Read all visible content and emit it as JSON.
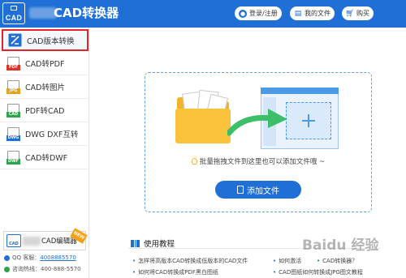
{
  "header": {
    "logo_text": "CAD",
    "title": "CAD转换器",
    "buttons": [
      {
        "label": "登录/注册",
        "icon": "user-icon"
      },
      {
        "label": "我的文件",
        "icon": "file-icon"
      },
      {
        "label": "购买",
        "icon": "cart-icon"
      }
    ]
  },
  "sidebar": {
    "items": [
      {
        "label": "CAD版本转换",
        "icon": "cad-version-icon",
        "band": "",
        "color": "#1f6fd6",
        "active": true
      },
      {
        "label": "CAD转PDF",
        "icon": "pdf-icon",
        "band": "PDF",
        "color": "#d9362a"
      },
      {
        "label": "CAD转图片",
        "icon": "image-icon",
        "band": "JPG",
        "color": "#e9a21c"
      },
      {
        "label": "PDF转CAD",
        "icon": "pdf-to-cad-icon",
        "band": "CAD",
        "color": "#2ea34a"
      },
      {
        "label": "DWG DXF互转",
        "icon": "dwg-dxf-icon",
        "band": "DWG",
        "color": "#1f6fd6"
      },
      {
        "label": "CAD转DWF",
        "icon": "dwf-icon",
        "band": "DWF",
        "color": "#2ea34a"
      }
    ],
    "editor_promo": {
      "label": "CAD编辑器",
      "badge": "NEW"
    },
    "qq_label": "QQ 客服：",
    "qq_number": "4008885570",
    "phone_label": "咨询热线：400-888-5570"
  },
  "main": {
    "hint": "批量拖拽文件到这里也可以添加文件哦 ~",
    "add_button": "添加文件",
    "tutorial_title": "使用教程",
    "tutorials": [
      "怎样将高版本CAD转换成低版本的CAD文件",
      "如何激活",
      "CAD转换器？",
      "如何将CAD转换成PDF黑白图纸",
      "CAD图纸如何转换成JPG图文教程"
    ]
  },
  "watermark": "Baidu 经验",
  "colors": {
    "brand": "#1f6fd6",
    "active_border": "#e0262c",
    "folder": "#f8c33a",
    "arrow": "#3dbf6a"
  }
}
